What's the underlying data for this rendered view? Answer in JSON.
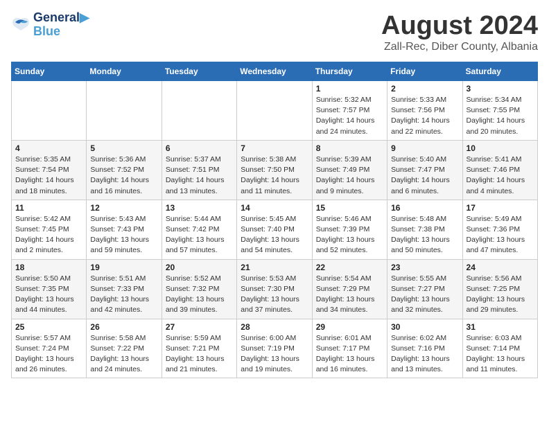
{
  "logo": {
    "line1": "General",
    "line2": "Blue"
  },
  "title": "August 2024",
  "location": "Zall-Rec, Diber County, Albania",
  "headers": [
    "Sunday",
    "Monday",
    "Tuesday",
    "Wednesday",
    "Thursday",
    "Friday",
    "Saturday"
  ],
  "weeks": [
    [
      {
        "day": "",
        "info": ""
      },
      {
        "day": "",
        "info": ""
      },
      {
        "day": "",
        "info": ""
      },
      {
        "day": "",
        "info": ""
      },
      {
        "day": "1",
        "info": "Sunrise: 5:32 AM\nSunset: 7:57 PM\nDaylight: 14 hours\nand 24 minutes."
      },
      {
        "day": "2",
        "info": "Sunrise: 5:33 AM\nSunset: 7:56 PM\nDaylight: 14 hours\nand 22 minutes."
      },
      {
        "day": "3",
        "info": "Sunrise: 5:34 AM\nSunset: 7:55 PM\nDaylight: 14 hours\nand 20 minutes."
      }
    ],
    [
      {
        "day": "4",
        "info": "Sunrise: 5:35 AM\nSunset: 7:54 PM\nDaylight: 14 hours\nand 18 minutes."
      },
      {
        "day": "5",
        "info": "Sunrise: 5:36 AM\nSunset: 7:52 PM\nDaylight: 14 hours\nand 16 minutes."
      },
      {
        "day": "6",
        "info": "Sunrise: 5:37 AM\nSunset: 7:51 PM\nDaylight: 14 hours\nand 13 minutes."
      },
      {
        "day": "7",
        "info": "Sunrise: 5:38 AM\nSunset: 7:50 PM\nDaylight: 14 hours\nand 11 minutes."
      },
      {
        "day": "8",
        "info": "Sunrise: 5:39 AM\nSunset: 7:49 PM\nDaylight: 14 hours\nand 9 minutes."
      },
      {
        "day": "9",
        "info": "Sunrise: 5:40 AM\nSunset: 7:47 PM\nDaylight: 14 hours\nand 6 minutes."
      },
      {
        "day": "10",
        "info": "Sunrise: 5:41 AM\nSunset: 7:46 PM\nDaylight: 14 hours\nand 4 minutes."
      }
    ],
    [
      {
        "day": "11",
        "info": "Sunrise: 5:42 AM\nSunset: 7:45 PM\nDaylight: 14 hours\nand 2 minutes."
      },
      {
        "day": "12",
        "info": "Sunrise: 5:43 AM\nSunset: 7:43 PM\nDaylight: 13 hours\nand 59 minutes."
      },
      {
        "day": "13",
        "info": "Sunrise: 5:44 AM\nSunset: 7:42 PM\nDaylight: 13 hours\nand 57 minutes."
      },
      {
        "day": "14",
        "info": "Sunrise: 5:45 AM\nSunset: 7:40 PM\nDaylight: 13 hours\nand 54 minutes."
      },
      {
        "day": "15",
        "info": "Sunrise: 5:46 AM\nSunset: 7:39 PM\nDaylight: 13 hours\nand 52 minutes."
      },
      {
        "day": "16",
        "info": "Sunrise: 5:48 AM\nSunset: 7:38 PM\nDaylight: 13 hours\nand 50 minutes."
      },
      {
        "day": "17",
        "info": "Sunrise: 5:49 AM\nSunset: 7:36 PM\nDaylight: 13 hours\nand 47 minutes."
      }
    ],
    [
      {
        "day": "18",
        "info": "Sunrise: 5:50 AM\nSunset: 7:35 PM\nDaylight: 13 hours\nand 44 minutes."
      },
      {
        "day": "19",
        "info": "Sunrise: 5:51 AM\nSunset: 7:33 PM\nDaylight: 13 hours\nand 42 minutes."
      },
      {
        "day": "20",
        "info": "Sunrise: 5:52 AM\nSunset: 7:32 PM\nDaylight: 13 hours\nand 39 minutes."
      },
      {
        "day": "21",
        "info": "Sunrise: 5:53 AM\nSunset: 7:30 PM\nDaylight: 13 hours\nand 37 minutes."
      },
      {
        "day": "22",
        "info": "Sunrise: 5:54 AM\nSunset: 7:29 PM\nDaylight: 13 hours\nand 34 minutes."
      },
      {
        "day": "23",
        "info": "Sunrise: 5:55 AM\nSunset: 7:27 PM\nDaylight: 13 hours\nand 32 minutes."
      },
      {
        "day": "24",
        "info": "Sunrise: 5:56 AM\nSunset: 7:25 PM\nDaylight: 13 hours\nand 29 minutes."
      }
    ],
    [
      {
        "day": "25",
        "info": "Sunrise: 5:57 AM\nSunset: 7:24 PM\nDaylight: 13 hours\nand 26 minutes."
      },
      {
        "day": "26",
        "info": "Sunrise: 5:58 AM\nSunset: 7:22 PM\nDaylight: 13 hours\nand 24 minutes."
      },
      {
        "day": "27",
        "info": "Sunrise: 5:59 AM\nSunset: 7:21 PM\nDaylight: 13 hours\nand 21 minutes."
      },
      {
        "day": "28",
        "info": "Sunrise: 6:00 AM\nSunset: 7:19 PM\nDaylight: 13 hours\nand 19 minutes."
      },
      {
        "day": "29",
        "info": "Sunrise: 6:01 AM\nSunset: 7:17 PM\nDaylight: 13 hours\nand 16 minutes."
      },
      {
        "day": "30",
        "info": "Sunrise: 6:02 AM\nSunset: 7:16 PM\nDaylight: 13 hours\nand 13 minutes."
      },
      {
        "day": "31",
        "info": "Sunrise: 6:03 AM\nSunset: 7:14 PM\nDaylight: 13 hours\nand 11 minutes."
      }
    ]
  ]
}
